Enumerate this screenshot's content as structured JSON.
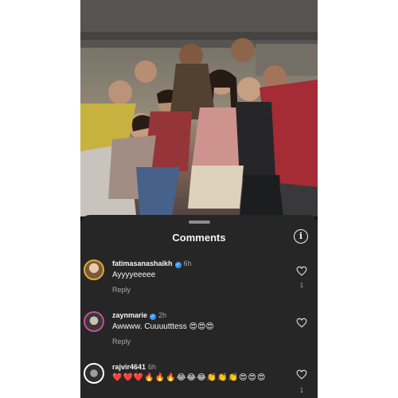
{
  "sheet": {
    "title": "Comments"
  },
  "comments": [
    {
      "username": "fatimasanashaikh",
      "time": "6h",
      "text": "Ayyyyeeeee",
      "reply": "Reply",
      "likes": "1",
      "verified": true
    },
    {
      "username": "zaynmarie",
      "time": "2h",
      "text": "Awwww. Cuuuutttess 😍😍😍",
      "reply": "Reply",
      "likes": "",
      "verified": true
    },
    {
      "username": "rajvir4641",
      "time": "6h",
      "text": "❤️❤️❤️🔥🔥🔥😂😂😂👏👏👏😍😍😍",
      "reply": "",
      "likes": "1",
      "verified": false
    }
  ],
  "icons": [
    "info-icon",
    "heart-icon",
    "verified-badge-icon"
  ]
}
